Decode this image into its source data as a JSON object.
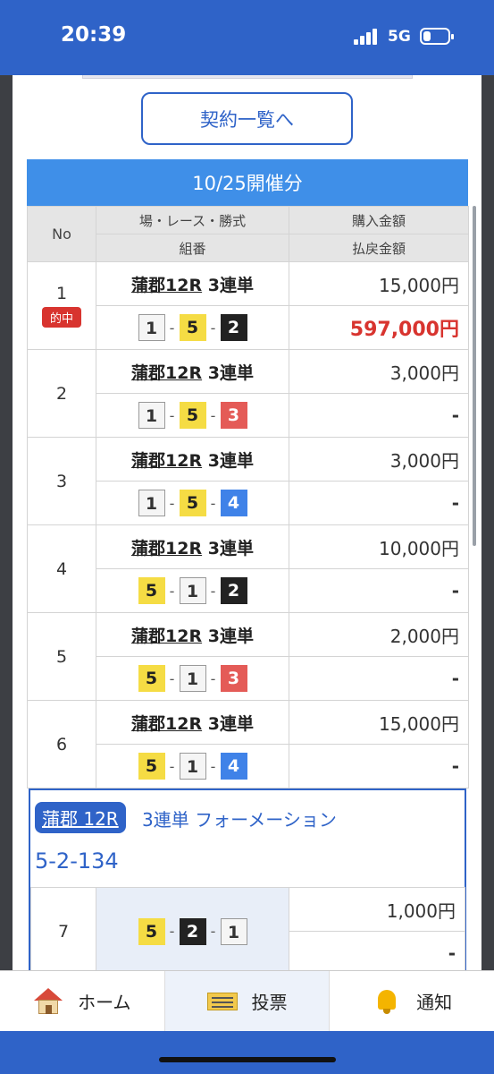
{
  "status_bar": {
    "time": "20:39",
    "network": "5G",
    "icons": [
      "signal-icon",
      "battery-icon"
    ]
  },
  "contract_button": {
    "label": "契約一覧へ"
  },
  "date_header": {
    "label": "10/25開催分"
  },
  "table": {
    "headers": {
      "no": "No",
      "race": "場・レース・勝式",
      "combo": "組番",
      "purchase": "購入金額",
      "payout": "払戻金額"
    },
    "hit_label": "的中",
    "rows": [
      {
        "no": "1",
        "venue": "蒲郡12R",
        "bet_type": "3連単",
        "combo": [
          1,
          5,
          2
        ],
        "amount": "15,000円",
        "payout": "597,000円",
        "hit": true
      },
      {
        "no": "2",
        "venue": "蒲郡12R",
        "bet_type": "3連単",
        "combo": [
          1,
          5,
          3
        ],
        "amount": "3,000円",
        "payout": "-",
        "hit": false
      },
      {
        "no": "3",
        "venue": "蒲郡12R",
        "bet_type": "3連単",
        "combo": [
          1,
          5,
          4
        ],
        "amount": "3,000円",
        "payout": "-",
        "hit": false
      },
      {
        "no": "4",
        "venue": "蒲郡12R",
        "bet_type": "3連単",
        "combo": [
          5,
          1,
          2
        ],
        "amount": "10,000円",
        "payout": "-",
        "hit": false
      },
      {
        "no": "5",
        "venue": "蒲郡12R",
        "bet_type": "3連単",
        "combo": [
          5,
          1,
          3
        ],
        "amount": "2,000円",
        "payout": "-",
        "hit": false
      },
      {
        "no": "6",
        "venue": "蒲郡12R",
        "bet_type": "3連単",
        "combo": [
          5,
          1,
          4
        ],
        "amount": "15,000円",
        "payout": "-",
        "hit": false
      }
    ]
  },
  "formation": {
    "badge": "蒲郡 12R",
    "title": "3連単 フォーメーション",
    "code": "5-2-134",
    "row": {
      "no": "7",
      "combo": [
        5,
        2,
        1
      ],
      "amount": "1,000円",
      "payout": "-"
    }
  },
  "bottom_nav": {
    "items": [
      {
        "label": "ホーム",
        "icon": "home-icon"
      },
      {
        "label": "投票",
        "icon": "ticket-icon"
      },
      {
        "label": "通知",
        "icon": "bell-icon"
      }
    ]
  },
  "colors": {
    "brand": "#2f63c8",
    "header": "#3f8fe8",
    "hit": "#d8342f",
    "boat1": "#f5f5f5",
    "boat2": "#222222",
    "boat3": "#e45b57",
    "boat4": "#3f82e8",
    "boat5": "#f5dc44"
  }
}
